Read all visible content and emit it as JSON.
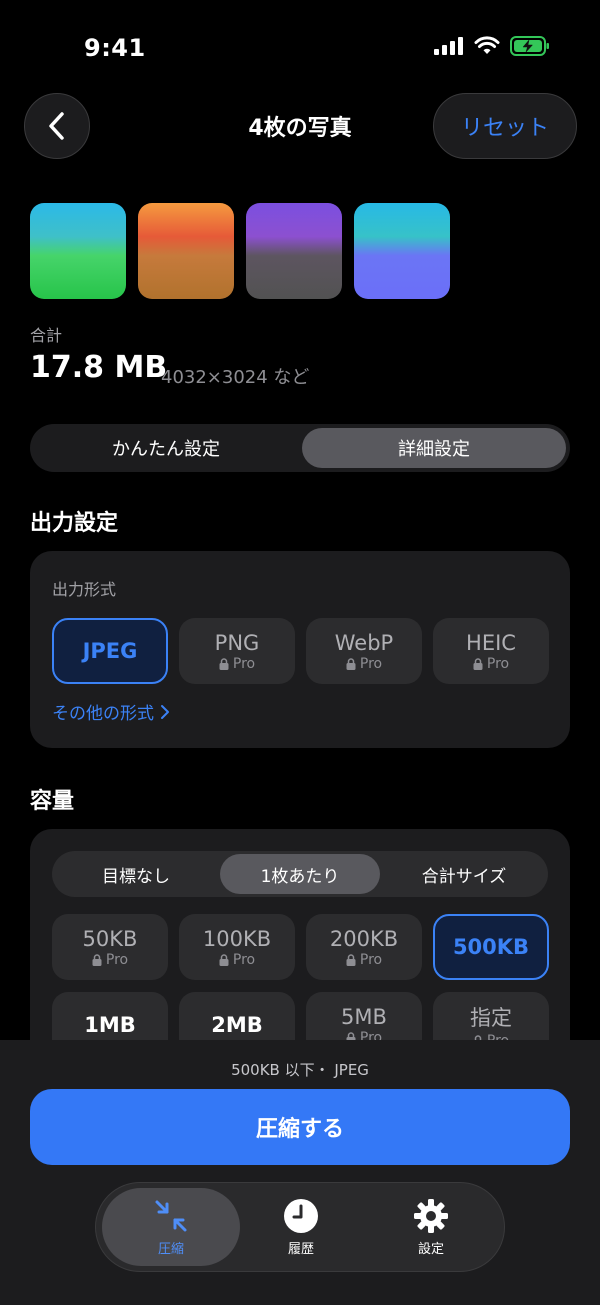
{
  "status_bar": {
    "time": "9:41"
  },
  "nav": {
    "title": "4枚の写真",
    "reset_label": "リセット"
  },
  "summary": {
    "total_label": "合計",
    "total_size": "17.8 MB",
    "dimensions": "4032×3024 など"
  },
  "mode_tabs": {
    "simple": "かんたん設定",
    "advanced": "詳細設定",
    "selected": "advanced"
  },
  "output_section": {
    "title": "出力設定",
    "format_label": "出力形式",
    "formats": [
      {
        "label": "JPEG",
        "sub": "",
        "selected": true
      },
      {
        "label": "PNG",
        "sub": "Pro",
        "selected": false
      },
      {
        "label": "WebP",
        "sub": "Pro",
        "selected": false
      },
      {
        "label": "HEIC",
        "sub": "Pro",
        "selected": false
      }
    ],
    "other_formats_link": "その他の形式"
  },
  "capacity_section": {
    "title": "容量",
    "modes": [
      "目標なし",
      "1枚あたり",
      "合計サイズ"
    ],
    "selected_mode": "1枚あたり",
    "sizes": [
      {
        "label": "50KB",
        "sub": "Pro"
      },
      {
        "label": "100KB",
        "sub": "Pro"
      },
      {
        "label": "200KB",
        "sub": "Pro"
      },
      {
        "label": "500KB",
        "sub": ""
      },
      {
        "label": "1MB",
        "sub": ""
      },
      {
        "label": "2MB",
        "sub": ""
      },
      {
        "label": "5MB",
        "sub": "Pro"
      },
      {
        "label": "指定",
        "sub": "Pro"
      }
    ],
    "selected_size": "500KB"
  },
  "bottom": {
    "summary_text": "500KB 以下・ JPEG",
    "compress_button": "圧縮する"
  },
  "tab_bar": {
    "items": [
      {
        "label": "圧縮",
        "icon": "compress-icon",
        "active": true
      },
      {
        "label": "履歴",
        "icon": "clock-icon",
        "active": false
      },
      {
        "label": "設定",
        "icon": "gear-icon",
        "active": false
      }
    ]
  },
  "colors": {
    "accent": "#3478f6",
    "background": "#000000",
    "card": "#1c1c1e"
  }
}
